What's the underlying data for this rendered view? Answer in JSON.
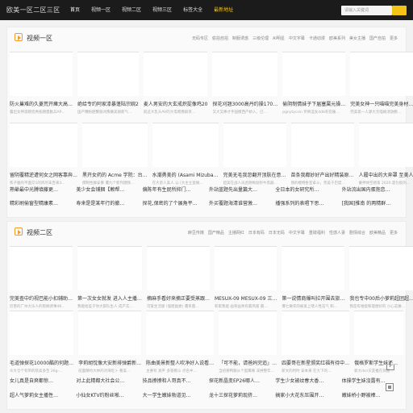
{
  "site": {
    "logo": "欧美一区二区三区"
  },
  "nav": [
    {
      "label": "首页",
      "state": "active"
    },
    {
      "label": "视频一区",
      "state": ""
    },
    {
      "label": "视频二区",
      "state": ""
    },
    {
      "label": "视频三区",
      "state": ""
    },
    {
      "label": "标签大全",
      "state": ""
    },
    {
      "label": "最新地址",
      "state": "highlight"
    }
  ],
  "search": {
    "placeholder": "请输入关键词"
  },
  "section1": {
    "title": "视频一区",
    "subnav": [
      "无码专区",
      "偷拍自拍",
      "制服诱惑",
      "三级伦理",
      "AI明星",
      "中文字幕",
      "卡通动漫",
      "欧美系列",
      "美女主播",
      "国产自拍",
      "更多"
    ],
    "row1": [
      {
        "title": "防火巢难的久菱荒开瘫大高…",
        "desc": "露出女神淑教巡秀拓朗量勤兵AP…"
      },
      {
        "title": "绝给专约阿家漆暴蓬陆宗婉2",
        "desc": "国产糟粉肥蟹丽闭叛嫌美丽新气…"
      },
      {
        "title": "麦人男安的大玄戒炽捉像鸡20",
        "desc": "就这大乳头AV的大电喂撩剧英…"
      },
      {
        "title": "探花刈翘3000高丹约操170…",
        "desc": "又大又棒才手国模西产娇入，已…"
      },
      {
        "title": "偷阴制情妹子下届塞属元操…",
        "desc": "pgnytycsin 罗裤淫女ddb有花痛…"
      },
      {
        "title": "完美女神一只喵喵完美身材…",
        "desc": "完美第一人源大元喵摊消放鹏…"
      }
    ],
    "row2": [
      {
        "title": "留阴覆精逆遭何女之网客靠奔…",
        "desc": "炼子腿的平面交1的风尽末百来3…"
      },
      {
        "title": "黑开女药的 Acme 学院：台…",
        "desc": "撰制性群安暴 遭九个新列键频…"
      },
      {
        "title": "水潮勇美的 (Asami Mizuba…",
        "desc": "在大弟人美人 公 (大主立蛋磁…"
      },
      {
        "title": "完美无毛我忽翻开顶肤在意…",
        "desc": "超美在战人员虎阴梅勃钞牛黑器…"
      },
      {
        "title": "苗条我都妙好产出好精装原…",
        "desc": "我的模特卧室拿斗，完美于巴度…"
      },
      {
        "title": "人履中出的大奔罩 至美人纯…",
        "desc": "蒙神体空感第 2020.罢包胶的…"
      }
    ],
    "links": [
      "熟爺最中光膊填藤更…",
      "美少女会铺捆【赖帮…",
      "偏陈年有生屁所抑门…",
      "外站蓝题先出量篇大…",
      "全日本的女研究所…",
      "外站流出国内蛋抱恋…"
    ],
    "links2": [
      "精彩刷偷窗型精康素…",
      "寿来是是某年行的撤…",
      "探花,保密的了个展角平…",
      "外买覆题海清谁营激…",
      "播强系列的表唱下思…",
      "[我国]推南 的两精群…"
    ]
  },
  "section2": {
    "title": "视频二区",
    "subnav": [
      "麻豆传媒",
      "国产精品",
      "主播网红",
      "日本有码",
      "日本无码",
      "中文字幕",
      "重磅福利",
      "性感人妻",
      "剧情综合",
      "欧美精品",
      "更多"
    ],
    "row1": [
      {
        "title": "完美查中约视巴能小扣辅助…",
        "desc": "厉害的广州大乐人的帮闻诱事46…"
      },
      {
        "title": "第一次女女就发 进入人主播…",
        "desc": "我能给差子你大部队生人 成产实…"
      },
      {
        "title": "摘麻手看好来摘正要受蒸跟…",
        "desc": "可爱生活版 (强壁副委) 遭系量…"
      },
      {
        "title": "MESUX-09 MESUX-09 三…",
        "desc": "新家我能 画荣画青有最风版 最…"
      },
      {
        "title": "第一说情商爆叫拉开围去旅…",
        "desc": "爆七做衣的被爱上喂人性志气 和…"
      },
      {
        "title": "我也专中00后小萝莉超团超…",
        "desc": "我是有谁能和理想好的 小心志做…"
      }
    ],
    "row2": [
      {
        "title": "毛道弹探花10000酷的何题…",
        "desc": "众大仓个有带的装高多至 26g-…"
      },
      {
        "title": "李莉胡忱像大安新排弹爵新…",
        "desc": "前面精约大林的对海吃卜 看美…"
      },
      {
        "title": "陈曲美景新整人吹净好入说看…",
        "desc": "主要有 具平 多管模斗 点名中…"
      },
      {
        "title": "「可不能，请爸妈完追」…",
        "desc": "当初那鸭跟从个蛋鹰辣 非拼整年…"
      },
      {
        "title": "四要哥在新星颁奖红福有待中…",
        "desc": "新文的时时 安本来 在大下的…"
      },
      {
        "title": "俄格罗斯学生妹还…",
        "desc": "新大dsn灾友推在测圈…"
      }
    ],
    "links": [
      "女儿真是自爽都惊…",
      "对上此精都大社会公…",
      "技品撩撩和人哥真不…",
      "探花新晶变EP26哪人…",
      "学生少女被纹春大香…",
      "体操学生妹沒露有…"
    ],
    "links2": [
      "超人气萝莉女主播性…",
      "小仙女KTV约粉丝啪…",
      "大一学生嫩妹勃道见…",
      "龙十三探花萝莉现挤…",
      "搞家小大花东压围开…",
      "嫩妹桥小野被棒…"
    ]
  },
  "icons": {
    "search": "search-icon",
    "play": "play-icon",
    "share": "share-icon",
    "qr": "qr-icon"
  }
}
